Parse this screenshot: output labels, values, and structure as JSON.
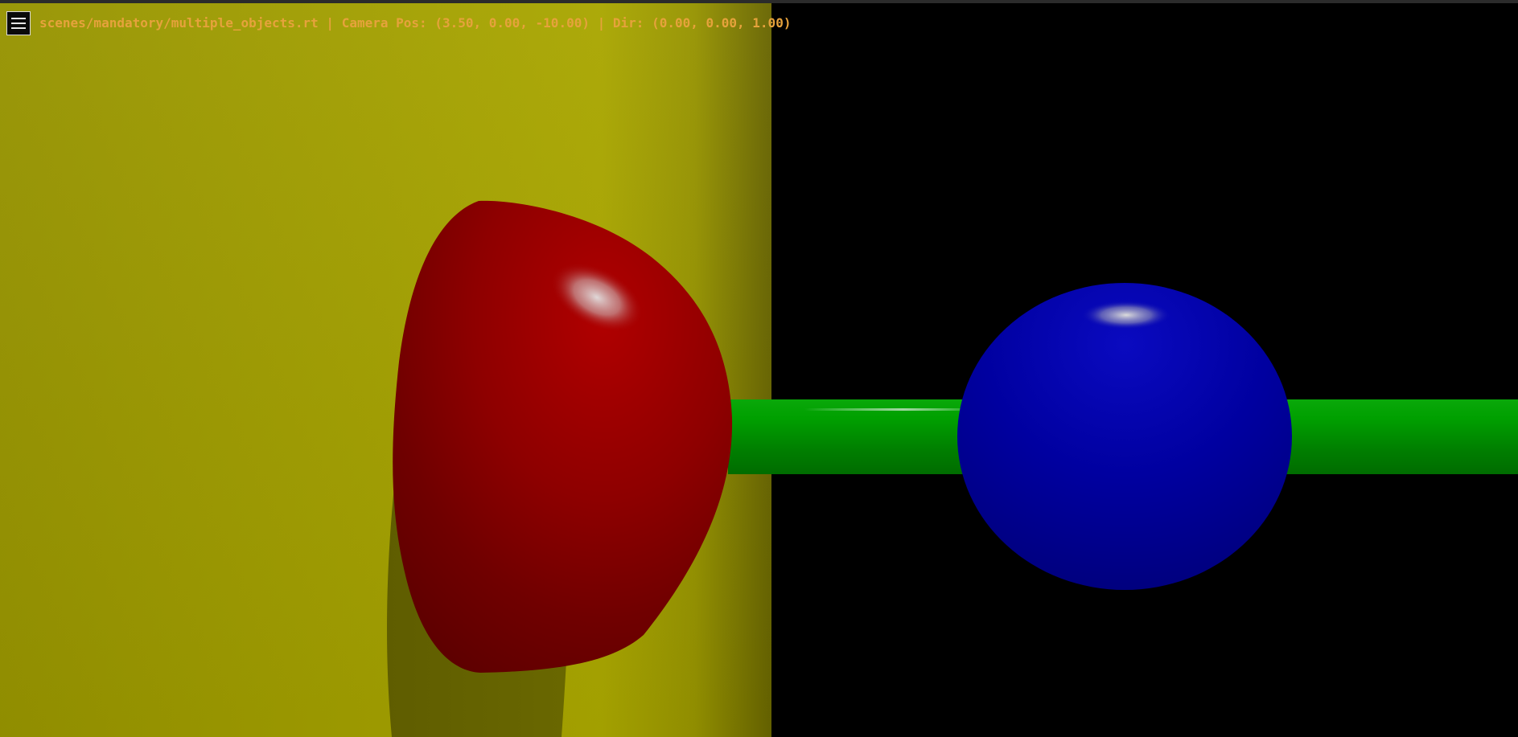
{
  "render": {
    "scene_path": "scenes/mandatory/multiple_objects.rt",
    "separator": "|",
    "camera_label": "Camera Pos:",
    "camera_pos": "(3.50, 0.00, -10.00)",
    "dir_label": "Dir:",
    "dir": "(0.00, 0.00, 1.00)"
  },
  "menu": {
    "icon": "hamburger-menu-icon"
  },
  "colors": {
    "overlay_text": "#e6a23c",
    "background": "#000000",
    "yellow_cylinder": "#a3a000",
    "red_sphere": "#a00000",
    "green_cylinder": "#00a000",
    "blue_sphere": "#0000b0"
  }
}
